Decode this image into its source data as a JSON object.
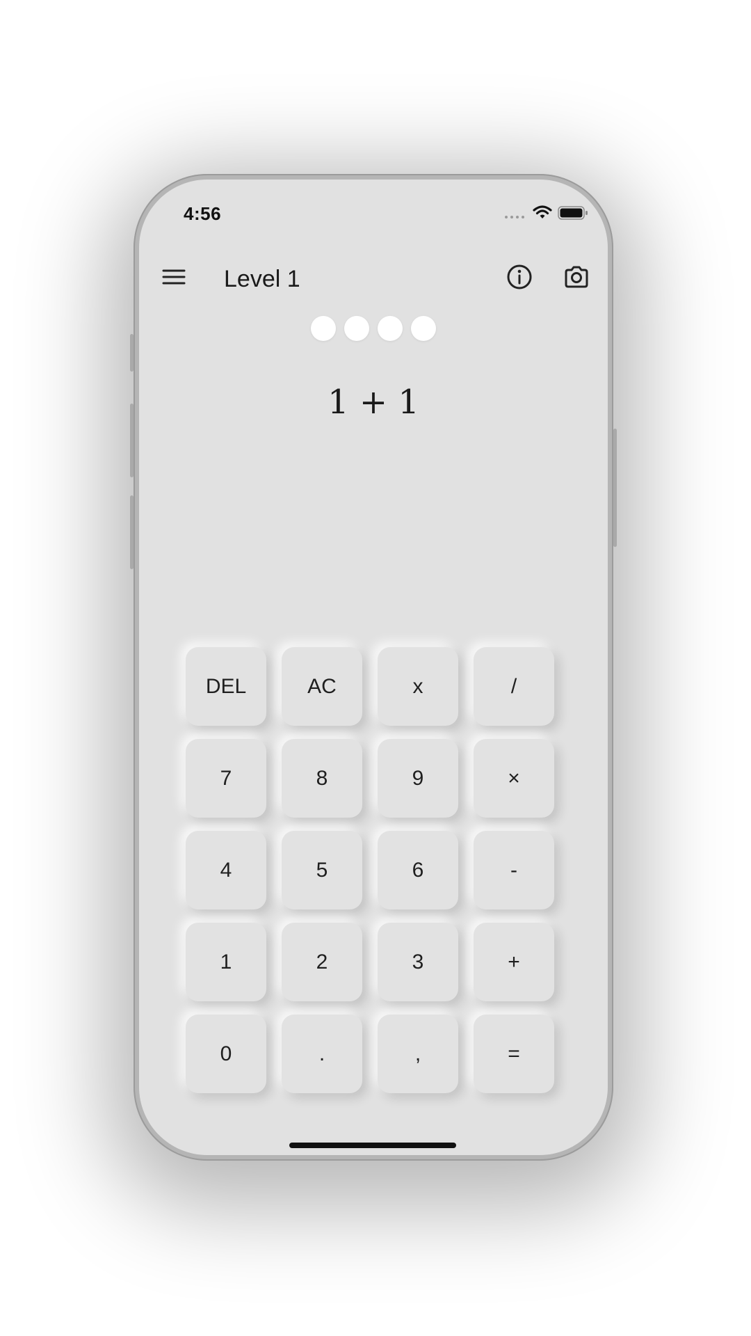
{
  "status_bar": {
    "time": "4:56"
  },
  "app_bar": {
    "title": "Level 1",
    "menu_icon": "hamburger-menu-icon",
    "info_icon": "info-icon",
    "camera_icon": "camera-icon"
  },
  "progress": {
    "dots_total": 4
  },
  "expression": "1 + 1",
  "keypad": {
    "keys": [
      "DEL",
      "AC",
      "x",
      "/",
      "7",
      "8",
      "9",
      "×",
      "4",
      "5",
      "6",
      "-",
      "1",
      "2",
      "3",
      "+",
      "0",
      ".",
      ",",
      "="
    ]
  },
  "colors": {
    "screen_background": "#e1e1e1",
    "key_background": "#e2e2e2",
    "dot": "#ffffff",
    "text": "#1a1a1a"
  }
}
